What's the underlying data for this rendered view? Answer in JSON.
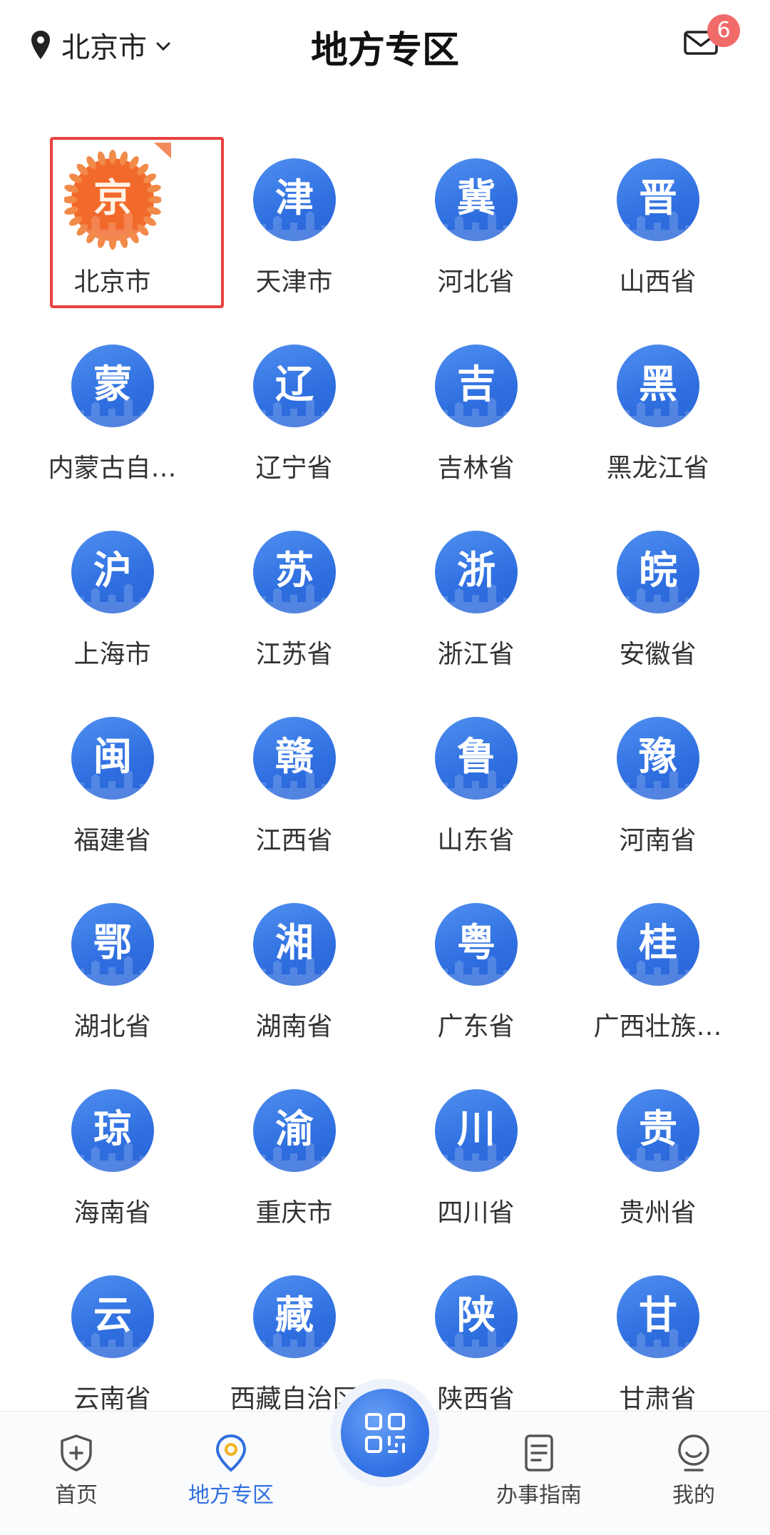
{
  "header": {
    "location": "北京市",
    "title": "地方专区",
    "unread_count": "6"
  },
  "regions": [
    {
      "glyph": "京",
      "label": "北京市"
    },
    {
      "glyph": "津",
      "label": "天津市"
    },
    {
      "glyph": "冀",
      "label": "河北省"
    },
    {
      "glyph": "晋",
      "label": "山西省"
    },
    {
      "glyph": "蒙",
      "label": "内蒙古自…"
    },
    {
      "glyph": "辽",
      "label": "辽宁省"
    },
    {
      "glyph": "吉",
      "label": "吉林省"
    },
    {
      "glyph": "黑",
      "label": "黑龙江省"
    },
    {
      "glyph": "沪",
      "label": "上海市"
    },
    {
      "glyph": "苏",
      "label": "江苏省"
    },
    {
      "glyph": "浙",
      "label": "浙江省"
    },
    {
      "glyph": "皖",
      "label": "安徽省"
    },
    {
      "glyph": "闽",
      "label": "福建省"
    },
    {
      "glyph": "赣",
      "label": "江西省"
    },
    {
      "glyph": "鲁",
      "label": "山东省"
    },
    {
      "glyph": "豫",
      "label": "河南省"
    },
    {
      "glyph": "鄂",
      "label": "湖北省"
    },
    {
      "glyph": "湘",
      "label": "湖南省"
    },
    {
      "glyph": "粤",
      "label": "广东省"
    },
    {
      "glyph": "桂",
      "label": "广西壮族…"
    },
    {
      "glyph": "琼",
      "label": "海南省"
    },
    {
      "glyph": "渝",
      "label": "重庆市"
    },
    {
      "glyph": "川",
      "label": "四川省"
    },
    {
      "glyph": "贵",
      "label": "贵州省"
    },
    {
      "glyph": "云",
      "label": "云南省"
    },
    {
      "glyph": "藏",
      "label": "西藏自治区"
    },
    {
      "glyph": "陕",
      "label": "陕西省"
    },
    {
      "glyph": "甘",
      "label": "甘肃省"
    }
  ],
  "nav": {
    "home": "首页",
    "local": "地方专区",
    "guide": "办事指南",
    "mine": "我的"
  },
  "colors": {
    "accent": "#2f6fe0",
    "beijing_badge": "#f26a2b",
    "selection": "#e84040",
    "unread_badge": "#f26b6b"
  }
}
